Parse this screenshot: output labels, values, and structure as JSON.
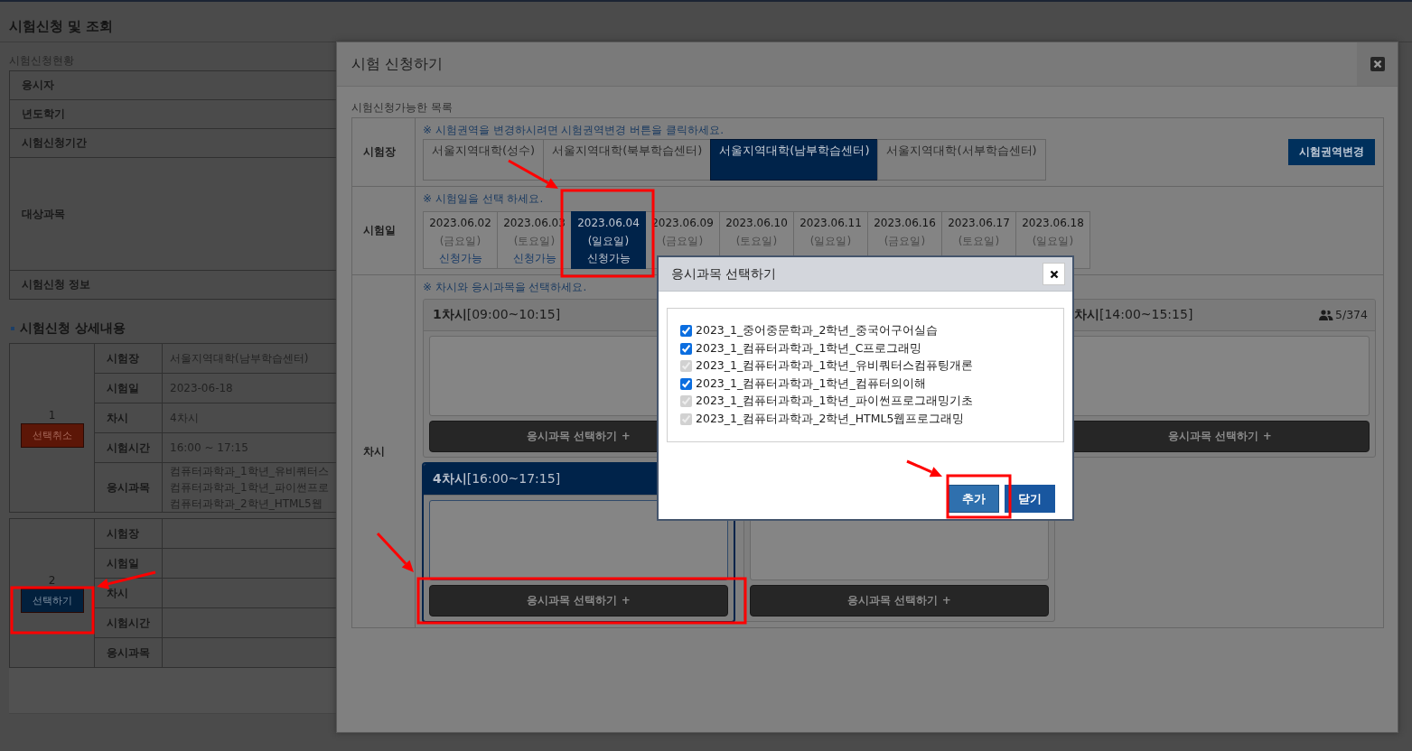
{
  "page": {
    "title": "시험신청 및 조회",
    "status_caption": "시험신청현황",
    "status_rows": [
      "응시자",
      "년도학기",
      "시험신청기간",
      "대상과목",
      "시험신청 정보"
    ],
    "detail_heading": "시험신청 상세내용",
    "details": [
      {
        "number": "1",
        "button": {
          "label": "선택취소",
          "kind": "cancel"
        },
        "rows": [
          {
            "label": "시험장",
            "values": [
              "서울지역대학(남부학습센터)"
            ]
          },
          {
            "label": "시험일",
            "values": [
              "2023-06-18"
            ]
          },
          {
            "label": "차시",
            "values": [
              "4차시"
            ]
          },
          {
            "label": "시험시간",
            "values": [
              "16:00 ~ 17:15"
            ]
          },
          {
            "label": "응시과목",
            "values": [
              "컴퓨터과학과_1학년_유비쿼터스",
              "컴퓨터과학과_1학년_파이썬프로",
              "컴퓨터과학과_2학년_HTML5웹"
            ]
          }
        ]
      },
      {
        "number": "2",
        "button": {
          "label": "선택하기",
          "kind": "select"
        },
        "rows": [
          {
            "label": "시험장"
          },
          {
            "label": "시험일"
          },
          {
            "label": "차시"
          },
          {
            "label": "시험시간"
          },
          {
            "label": "응시과목"
          }
        ]
      }
    ]
  },
  "modal": {
    "title": "시험 신청하기",
    "caption": "시험신청가능한 목록",
    "venue": {
      "label": "시험장",
      "hint": "※ 시험권역을 변경하시려면 시험권역변경 버튼을 클릭하세요.",
      "button": "시험권역변경",
      "tabs": [
        {
          "label": "서울지역대학(성수)",
          "selected": false
        },
        {
          "label": "서울지역대학(북부학습센터)",
          "selected": false
        },
        {
          "label": "서울지역대학(남부학습센터)",
          "selected": true
        },
        {
          "label": "서울지역대학(서부학습센터)",
          "selected": false
        }
      ]
    },
    "date": {
      "label": "시험일",
      "hint": "※ 시험일을 선택 하세요.",
      "dates": [
        {
          "date": "2023.06.02",
          "day": "(금요일)",
          "status": "신청가능",
          "selected": false
        },
        {
          "date": "2023.06.03",
          "day": "(토요일)",
          "status": "신청가능",
          "selected": false
        },
        {
          "date": "2023.06.04",
          "day": "(일요일)",
          "status": "신청가능",
          "selected": true
        },
        {
          "date": "2023.06.09",
          "day": "(금요일)",
          "selected": false
        },
        {
          "date": "2023.06.10",
          "day": "(토요일)",
          "selected": false
        },
        {
          "date": "2023.06.11",
          "day": "(일요일)",
          "selected": false
        },
        {
          "date": "2023.06.16",
          "day": "(금요일)",
          "selected": false
        },
        {
          "date": "2023.06.17",
          "day": "(토요일)",
          "selected": false
        },
        {
          "date": "2023.06.18",
          "day": "(일요일)",
          "selected": false
        }
      ]
    },
    "session": {
      "label": "차시",
      "hint": "※ 차시와 응시과목을 선택하세요.",
      "rows": [
        [
          {
            "kind": "card",
            "title": "**1차시**[09:00~10:15]",
            "selected": false,
            "button": "응시과목 선택하기 +"
          },
          {
            "kind": "covered"
          },
          {
            "kind": "card",
            "title": "**차시**[14:00~15:15]",
            "count": "5/374",
            "selected": false,
            "button": "응시과목 선택하기 +"
          }
        ],
        [
          {
            "kind": "card",
            "title": "**4차시**[16:00~17:15]",
            "selected": true,
            "button": "응시과목 선택하기 +"
          },
          {
            "kind": "card",
            "selected": false,
            "button": "응시과목 선택하기 +"
          }
        ]
      ]
    }
  },
  "dialog": {
    "title": "응시과목 선택하기",
    "items": [
      {
        "label": "2023_1_중어중문학과_2학년_중국어구어실습",
        "checked": true,
        "disabled": false
      },
      {
        "label": "2023_1_컴퓨터과학과_1학년_C프로그래밍",
        "checked": true,
        "disabled": false
      },
      {
        "label": "2023_1_컴퓨터과학과_1학년_유비쿼터스컴퓨팅개론",
        "checked": true,
        "disabled": true
      },
      {
        "label": "2023_1_컴퓨터과학과_1학년_컴퓨터의이해",
        "checked": true,
        "disabled": false
      },
      {
        "label": "2023_1_컴퓨터과학과_1학년_파이썬프로그래밍기초",
        "checked": true,
        "disabled": true
      },
      {
        "label": "2023_1_컴퓨터과학과_2학년_HTML5웹프로그래밍",
        "checked": true,
        "disabled": true
      }
    ],
    "buttons": [
      {
        "label": "추가",
        "kind": "primary"
      },
      {
        "label": "닫기",
        "kind": "secondary"
      }
    ]
  }
}
